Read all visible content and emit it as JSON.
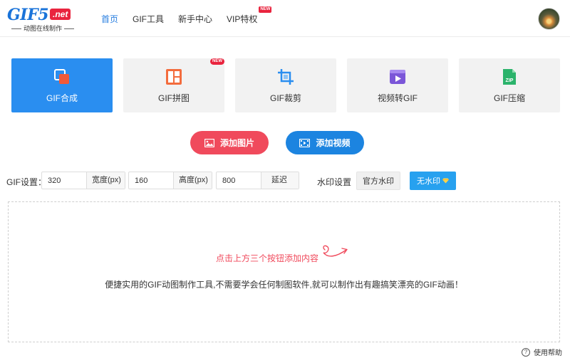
{
  "logo": {
    "main": "GIF5",
    "net": ".net",
    "subtitle": "动图在线制作"
  },
  "nav": {
    "items": [
      {
        "label": "首页"
      },
      {
        "label": "GIF工具"
      },
      {
        "label": "新手中心"
      },
      {
        "label": "VIP特权",
        "badge": "NEW"
      }
    ]
  },
  "tools": [
    {
      "label": "GIF合成",
      "icon": "layers-icon"
    },
    {
      "label": "GIF拼图",
      "icon": "collage-icon",
      "badge": "NEW"
    },
    {
      "label": "GIF裁剪",
      "icon": "crop-icon"
    },
    {
      "label": "视频转GIF",
      "icon": "video-icon"
    },
    {
      "label": "GIF压缩",
      "icon": "zip-icon",
      "icon_text": "ZIP"
    }
  ],
  "actions": {
    "add_image": "添加图片",
    "add_video": "添加视频"
  },
  "settings": {
    "label": "GIF设置：",
    "width": {
      "value": "320",
      "unit": "宽度(px)"
    },
    "height": {
      "value": "160",
      "unit": "高度(px)"
    },
    "delay": {
      "value": "800",
      "unit": "延迟"
    },
    "watermark_label": "水印设置",
    "official_watermark": "官方水印",
    "no_watermark": "无水印"
  },
  "dropzone": {
    "hint": "点击上方三个按钮添加内容",
    "description": "便捷实用的GIF动图制作工具,不需要学会任何制图软件,就可以制作出有趣搞笑漂亮的GIF动画！"
  },
  "help": {
    "label": "使用帮助",
    "icon": "?"
  },
  "colors": {
    "accent": "#2a8ef0",
    "red": "#f04a5c",
    "blue": "#1c84e0",
    "watermark_blue": "#27a1ef"
  }
}
